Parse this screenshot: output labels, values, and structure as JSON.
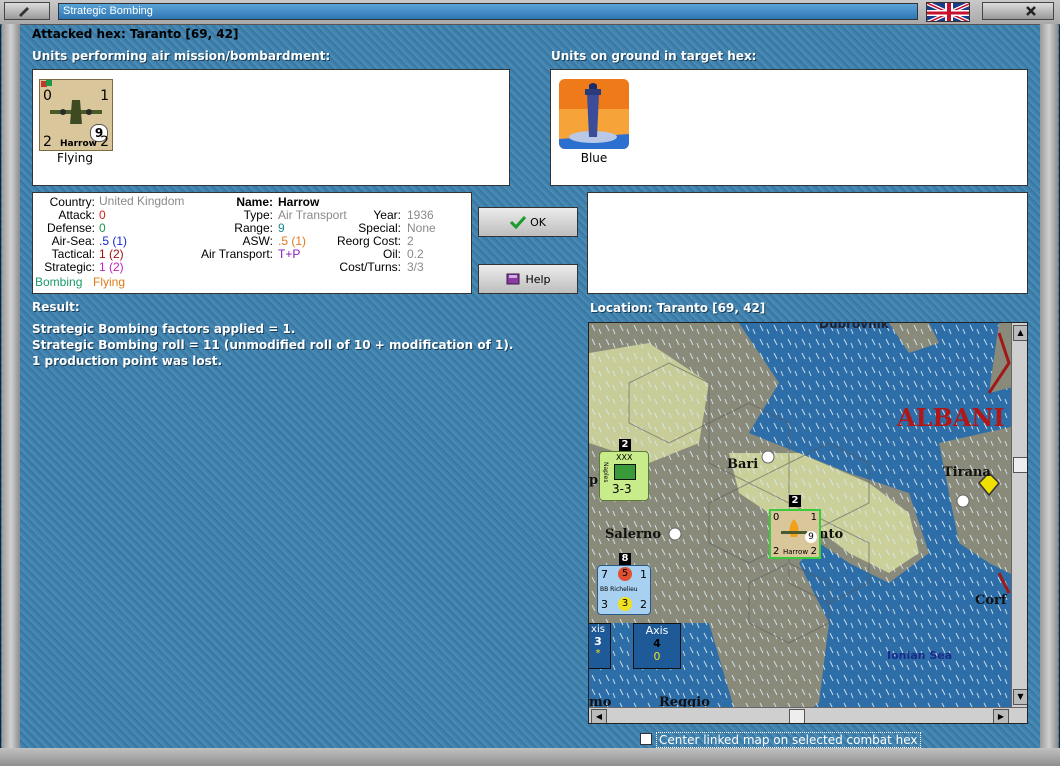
{
  "window": {
    "title": "Strategic Bombing"
  },
  "header": {
    "attacked_hex": "Attacked hex: Taranto  [69, 42]"
  },
  "air_units": {
    "label": "Units performing air mission/bombardment:",
    "unit": {
      "top_left": "0",
      "top_right": "1",
      "bottom_left": "2",
      "bottom_right": "2",
      "badge": "9",
      "name": "Harrow",
      "caption": "Flying"
    }
  },
  "ground_units": {
    "label": "Units on ground in target hex:",
    "unit": {
      "caption": "Blue"
    }
  },
  "details": {
    "country_label": "Country:",
    "country": "United Kingdom",
    "attack_label": "Attack:",
    "attack": "0",
    "defense_label": "Defense:",
    "defense": "0",
    "airsea_label": "Air-Sea:",
    "airsea": ".5 (1)",
    "tactical_label": "Tactical:",
    "tactical": "1 (2)",
    "strategic_label": "Strategic:",
    "strategic": "1 (2)",
    "bombing": "Bombing",
    "flying": "Flying",
    "name_label": "Name:",
    "name": "Harrow",
    "type_label": "Type:",
    "type": "Air Transport",
    "range_label": "Range:",
    "range": "9",
    "asw_label": "ASW:",
    "asw": ".5 (1)",
    "airtransport_label": "Air Transport:",
    "airtransport": "T+P",
    "year_label": "Year:",
    "year": "1936",
    "special_label": "Special:",
    "special": "None",
    "reorg_label": "Reorg Cost:",
    "reorg": "2",
    "oil_label": "Oil:",
    "oil": "0.2",
    "cost_label": "Cost/Turns:",
    "cost": "3/3"
  },
  "buttons": {
    "ok": "OK",
    "help": "Help"
  },
  "result": {
    "label": "Result:",
    "lines": [
      "Strategic Bombing factors applied = 1.",
      "Strategic Bombing roll = 11 (unmodified roll of 10 + modification of 1).",
      "1 production point was lost."
    ]
  },
  "location": {
    "label": "Location:  Taranto  [69, 42]",
    "places": {
      "albania": "ALBANI",
      "bari": "Bari",
      "salerno": "Salerno",
      "taranto": "nto",
      "tirana": "Tirana",
      "corfu": "Corf",
      "reggio": "Reggio",
      "ionian": "Ionian Sea",
      "dubrovnik": "Dubrovnik",
      "napoli": "pl",
      "amo": "mo"
    },
    "counters": {
      "army": {
        "stack": "2",
        "size": "XXX",
        "vertical": "Naples",
        "strength": "3-3"
      },
      "bomber": {
        "stack": "2",
        "tl": "0",
        "tr": "1",
        "badge": "9",
        "bl": "2",
        "br": "2",
        "name": "Harrow"
      },
      "ship": {
        "stack": "8",
        "tl": "7",
        "mid": "5",
        "tr": "1",
        "name": "BB Richelieu",
        "bl": "3",
        "mid2": "3",
        "br": "2"
      },
      "axis1": {
        "label": "xis",
        "value": "3",
        "sub": "*"
      },
      "axis2": {
        "label": "Axis",
        "value": "4",
        "sub": "0"
      }
    }
  },
  "footer": {
    "center_map_label": "Center linked map on selected combat hex"
  }
}
